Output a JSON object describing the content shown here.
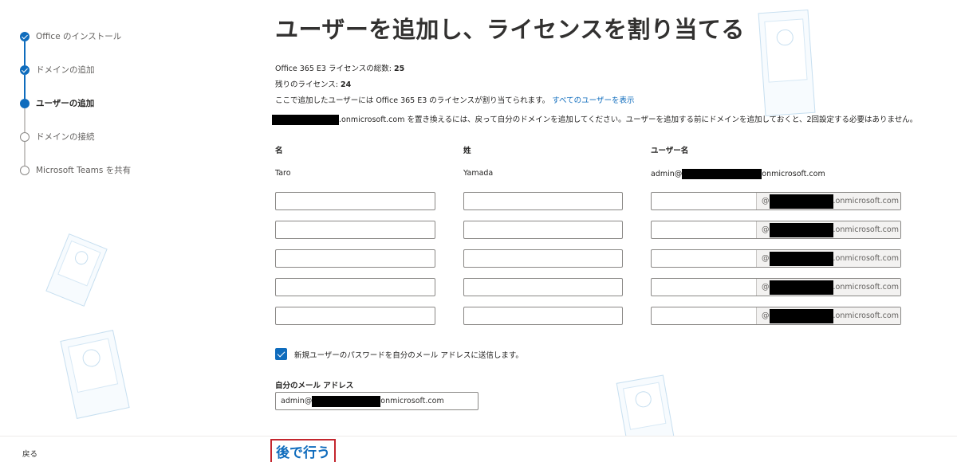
{
  "stepper": {
    "steps": [
      {
        "label": "Office のインストール",
        "state": "done"
      },
      {
        "label": "ドメインの追加",
        "state": "done"
      },
      {
        "label": "ユーザーの追加",
        "state": "active"
      },
      {
        "label": "ドメインの接続",
        "state": "pending"
      },
      {
        "label": "Microsoft Teams を共有",
        "state": "pending"
      }
    ]
  },
  "main": {
    "title": "ユーザーを追加し、ライセンスを割り当てる",
    "license_total_label": "Office 365 E3 ライセンスの総数: ",
    "license_total_value": "25",
    "license_remaining_label": "残りのライセンス: ",
    "license_remaining_value": "24",
    "assign_note": "ここで追加したユーザーには Office 365 E3 のライセンスが割り当てられます。",
    "view_all_users_link": "すべてのユーザーを表示",
    "domain_note": ".onmicrosoft.com を置き換えるには、戻って自分のドメインを追加してください。ユーザーを追加する前にドメインを追加しておくと、2回設定する必要はありません。",
    "columns": {
      "first_name": "名",
      "last_name": "姓",
      "username": "ユーザー名"
    },
    "first_user": {
      "first_name": "Taro",
      "last_name": "Yamada",
      "username_prefix": "admin@",
      "username_suffix": "onmicrosoft.com"
    },
    "domain_suffix_prefix": "@",
    "domain_suffix": ".onmicrosoft.com",
    "send_password_checked": true,
    "send_password_label": "新規ユーザーのパスワードを自分のメール アドレスに送信します。",
    "my_email_label": "自分のメール アドレス",
    "my_email_prefix": "admin@",
    "my_email_suffix": "onmicrosoft.com"
  },
  "footer": {
    "back_label": "戻る",
    "later_label": "後で行う"
  },
  "colors": {
    "accent": "#0f6cbd",
    "highlight_border": "#c4262e"
  }
}
